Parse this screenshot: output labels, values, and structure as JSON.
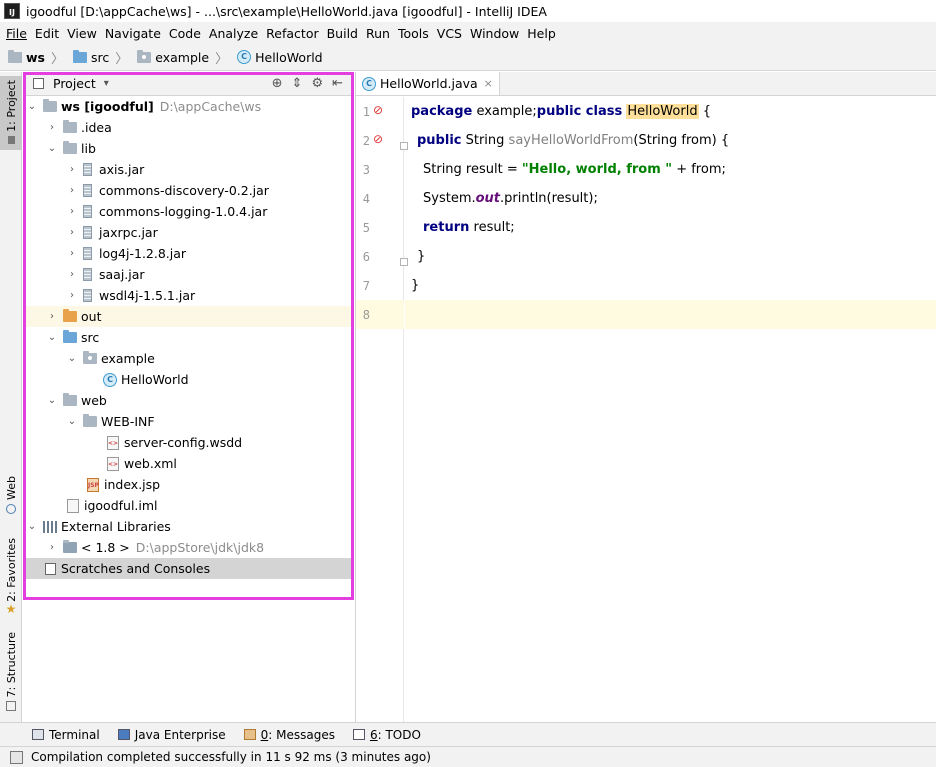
{
  "window": {
    "title": "igoodful [D:\\appCache\\ws] - ...\\src\\example\\HelloWorld.java [igoodful] - IntelliJ IDEA",
    "app_icon_text": "IJ"
  },
  "menu": [
    "File",
    "Edit",
    "View",
    "Navigate",
    "Code",
    "Analyze",
    "Refactor",
    "Build",
    "Run",
    "Tools",
    "VCS",
    "Window",
    "Help"
  ],
  "breadcrumb": [
    "ws",
    "src",
    "example",
    "HelloWorld"
  ],
  "left_strip": {
    "project": "1: Project",
    "web": "Web",
    "favorites": "2: Favorites",
    "structure": "7: Structure"
  },
  "project_panel": {
    "title": "Project",
    "dropdown": "▾"
  },
  "tree": [
    {
      "label": "ws [igoodful]",
      "path": "D:\\appCache\\ws"
    },
    {
      "label": ".idea"
    },
    {
      "label": "lib"
    },
    {
      "label": "axis.jar"
    },
    {
      "label": "commons-discovery-0.2.jar"
    },
    {
      "label": "commons-logging-1.0.4.jar"
    },
    {
      "label": "jaxrpc.jar"
    },
    {
      "label": "log4j-1.2.8.jar"
    },
    {
      "label": "saaj.jar"
    },
    {
      "label": "wsdl4j-1.5.1.jar"
    },
    {
      "label": "out"
    },
    {
      "label": "src"
    },
    {
      "label": "example"
    },
    {
      "label": "HelloWorld"
    },
    {
      "label": "web"
    },
    {
      "label": "WEB-INF"
    },
    {
      "label": "server-config.wsdd"
    },
    {
      "label": "web.xml"
    },
    {
      "label": "index.jsp"
    },
    {
      "label": "igoodful.iml"
    },
    {
      "label": "External Libraries"
    },
    {
      "label": "< 1.8 >",
      "path": "D:\\appStore\\jdk\\jdk8"
    },
    {
      "label": "Scratches and Consoles"
    }
  ],
  "editor": {
    "tab": "HelloWorld.java",
    "lines": [
      {
        "n": "1",
        "t": [
          "package",
          " example;",
          "public class",
          " ",
          "HelloWorld",
          " {"
        ]
      },
      {
        "n": "2",
        "t": [
          "public",
          " String ",
          "sayHelloWorldFrom",
          "(String from) {"
        ]
      },
      {
        "n": "3",
        "t": [
          "String result = ",
          "\"Hello, world, from \"",
          " + from;"
        ]
      },
      {
        "n": "4",
        "t": [
          "System.",
          "out",
          ".println(result);"
        ]
      },
      {
        "n": "5",
        "t": [
          "return",
          " result;"
        ]
      },
      {
        "n": "6",
        "t": [
          "}"
        ]
      },
      {
        "n": "7",
        "t": [
          "}"
        ]
      },
      {
        "n": "8",
        "t": []
      }
    ]
  },
  "bottom_tools": [
    {
      "label": "Terminal"
    },
    {
      "label": "Java Enterprise"
    },
    {
      "prefix": "0",
      "label": ": Messages"
    },
    {
      "prefix": "6",
      "label": ": TODO"
    }
  ],
  "status": "Compilation completed successfully in 11 s 92 ms (3 minutes ago)",
  "colors": {
    "highlight_border": "#e23ee0",
    "keyword": "#000080",
    "string": "#008000",
    "current_line": "#fffbe0"
  }
}
